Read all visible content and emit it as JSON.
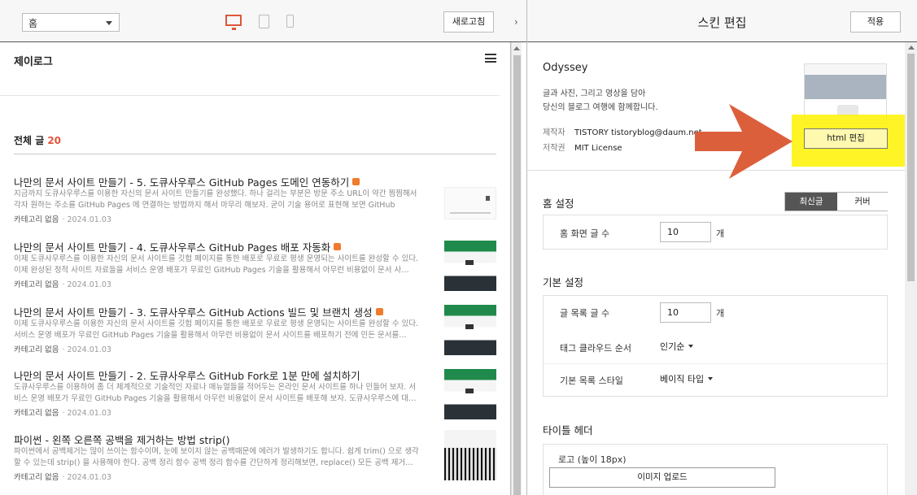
{
  "toolbar": {
    "page_select": "홈",
    "refresh_label": "새로고침",
    "collapse_glyph": "›"
  },
  "blog": {
    "title": "제이로그",
    "total_label": "전체 글",
    "total_count": "20"
  },
  "posts": [
    {
      "title": "나만의 문서 사이트 만들기 - 5. 도큐사우루스 GitHub Pages 도메인 연동하기",
      "summary": "지금까지 도큐사우루스를 이용한 자신의 문서 사이트 만들기를 완성했다. 하나 걸리는 부분은 방문 주소 URL이 약간 찜찜해서 각자 원하는 주소를 GitHub Pages 에 연결하는 방법까지 해서 마무리 해보자. 굳이 기술 용어로 표현해 보면 GitHub Page…",
      "category": "카테고리 없음",
      "date": "2024.01.03",
      "thumb": "white"
    },
    {
      "title": "나만의 문서 사이트 만들기 - 4. 도큐사우루스 GitHub Pages 배포 자동화",
      "summary": "이제 도큐사우루스를 이용한 자신의 문서 사이트를 깃헙 페이지를 통한 배포로 무료로 평생 운영되는 사이트를 완성할 수 있다. 이제 완성된 정적 사이트 자료들을 서비스 운영 배포가 무료인 GitHub Pages 기술을 활용해서 아무런 비용없이 문서 사…",
      "category": "카테고리 없음",
      "date": "2024.01.03",
      "thumb": "green"
    },
    {
      "title": "나만의 문서 사이트 만들기 - 3. 도큐사우루스 GitHub Actions 빌드 및 브랜치 생성",
      "summary": "이제 도큐사우루스를 이용한 자신의 문서 사이트를 깃헙 페이지를 통한 배포로 무료로 평생 운영되는 사이트를 완성할 수 있다. 서비스 운영 배포가 무료인 GitHub Pages 기술을 활용해서 아무런 비용없이 문서 사이트를 배포하기 전에 민든 문서를…",
      "category": "카테고리 없음",
      "date": "2024.01.03",
      "thumb": "green"
    },
    {
      "title": "나만의 문서 사이트 만들기 - 2. 도큐사우루스 GitHub Fork로 1분 만에 설치하기",
      "summary": "도큐사우루스를 이용하여 좀 더 체계적으로 기술적인 자료나 매뉴얼들을 적어두는 온라인 문서 사이트를 하나 민들어 보자. 서비스 운영 배포가 무료인 GitHub Pages 기술을 활용해서 아무런 비용없이 문서 사이트를 배포해 보자. 도큐사우루스에 대…",
      "category": "카테고리 없음",
      "date": "2024.01.03",
      "thumb": "green"
    },
    {
      "title": "파이썬 - 왼쪽 오른쪽 공백을 제거하는 방법 strip()",
      "summary": "파이썬에서 공백제거는 많이 쓰이는 함수이며, 눈에 보이지 않는 공백때문에 에러가 발생하기도 합니다. 쉽게 trim() 으로 생각할 수 있는데 strip() 을 사용해야 한다. 공백 정리 함수 공백 정리 함수를 간단하게 정리해보면, replace() 모든 공백 제거…",
      "category": "카테고리 없음",
      "date": "2024.01.03",
      "thumb": "trees"
    }
  ],
  "editor": {
    "title": "스킨 편집",
    "apply_label": "적용",
    "skin": {
      "name": "Odyssey",
      "desc_line1": "글과 사진, 그리고 영상을 담아",
      "desc_line2": "당신의 블로그 여행에 함께합니다.",
      "author_key": "제작자",
      "author_val": "TISTORY tistoryblog@daum.net",
      "license_key": "저작권",
      "license_val": "MIT License",
      "html_edit_label": "html 편집"
    },
    "home": {
      "title": "홈 설정",
      "seg_on": "최신글",
      "seg_off": "커버",
      "count_label": "홈 화면 글 수",
      "count_value": "10",
      "unit": "개"
    },
    "basic": {
      "title": "기본 설정",
      "list_label": "글 목록 글 수",
      "list_value": "10",
      "unit": "개",
      "tag_label": "태그 클라우드 순서",
      "tag_value": "인기순",
      "style_label": "기본 목록 스타일",
      "style_value": "베이직 타입"
    },
    "title_header": {
      "title": "타이틀 헤더",
      "logo_label": "로고 (높이 18px)",
      "upload_label": "이미지 업로드"
    }
  },
  "colors": {
    "accent": "#e0553b",
    "highlight": "#fff200",
    "new_badge": "#f07b2b"
  }
}
